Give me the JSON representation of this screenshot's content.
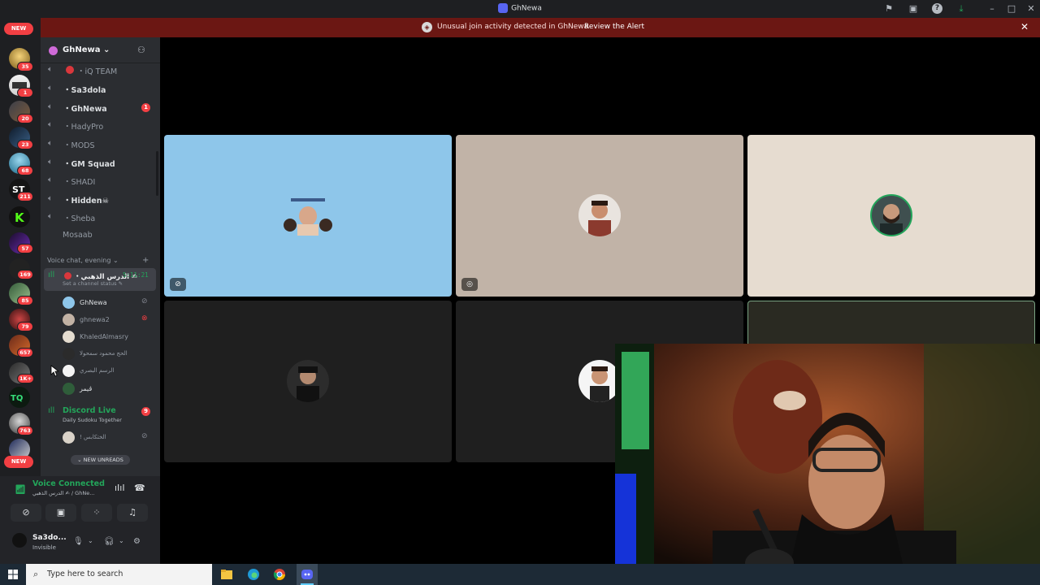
{
  "window": {
    "title": "GhNewa"
  },
  "alert": {
    "message": "Unusual join activity detected in GhNewa",
    "action": "Review the Alert"
  },
  "rail": {
    "new_top": "NEW",
    "new_bottom": "NEW",
    "badges": [
      "35",
      "1",
      "20",
      "23",
      "68",
      "211",
      "57",
      "169",
      "85",
      "79",
      "657",
      "1K+",
      "763"
    ]
  },
  "guild": {
    "name": "GhNewa"
  },
  "channels": [
    {
      "label": "・iQ TEAM"
    },
    {
      "label": "・Sa3dola"
    },
    {
      "label": "・GhNewa",
      "mention": "1"
    },
    {
      "label": "・HadyPro"
    },
    {
      "label": "・MODS"
    },
    {
      "label": "・GM Squad"
    },
    {
      "label": "・SHADI"
    },
    {
      "label": "・Hidden☠"
    },
    {
      "label": "・Sheba"
    },
    {
      "label": "Mosaab"
    }
  ],
  "category": {
    "label": "Voice chat, evening"
  },
  "active_channel": {
    "name": "・الدرس الذهبي ✍",
    "timer": "5:11:21",
    "status": "Set a channel status ✎"
  },
  "voice_users": [
    {
      "name": "GhNewa"
    },
    {
      "name": "ghnewa2"
    },
    {
      "name": "KhaledAlmasry"
    },
    {
      "name": "الحج محمود سمحولا"
    },
    {
      "name": "الرسم البصري"
    },
    {
      "name": "ڤيمر"
    }
  ],
  "live_channel": {
    "name": "Discord Live",
    "subtitle": "Daily Sudoku Together",
    "mention": "9"
  },
  "live_users": [
    {
      "name": "! الختكابس"
    }
  ],
  "new_unreads": "⌄ NEW UNREADS",
  "voice_panel": {
    "title": "Voice Connected",
    "subtitle": "الدرس الذهبي ✍ / GhNe..."
  },
  "me": {
    "name": "Sa3do...",
    "status": "Invisible"
  },
  "taskbar": {
    "search_placeholder": "Type here to search"
  },
  "colors": {
    "accent_green": "#23a55a",
    "alert_bg": "#6b1713",
    "mention_red": "#f23f43",
    "tile_blue": "#8ec6ea"
  }
}
